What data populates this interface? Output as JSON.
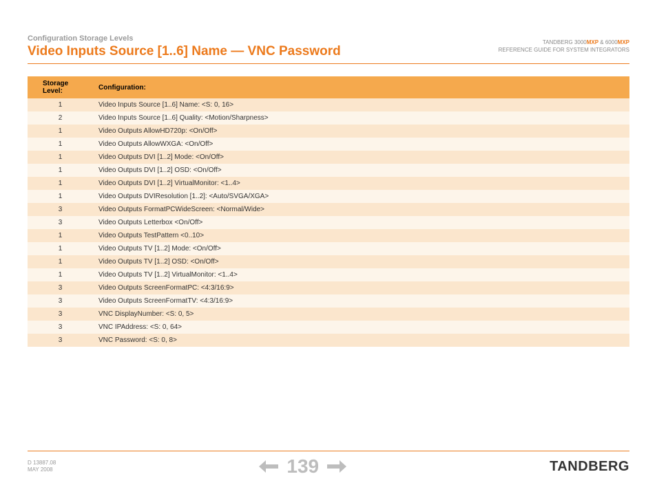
{
  "header": {
    "breadcrumb": "Configuration Storage Levels",
    "title": "Video Inputs Source [1..6] Name — VNC Password",
    "product_line_a": "TANDBERG 3000",
    "product_line_b": " & 6000",
    "mxp": "MXP",
    "subtitle": "REFERENCE GUIDE FOR SYSTEM INTEGRATORS"
  },
  "table": {
    "col1": "Storage Level:",
    "col2": "Configuration:",
    "rows": [
      {
        "level": "1",
        "config": "Video Inputs Source [1..6] Name: <S: 0, 16>"
      },
      {
        "level": "2",
        "config": "Video Inputs Source [1..6] Quality: <Motion/Sharpness>"
      },
      {
        "level": "1",
        "config": "Video Outputs AllowHD720p: <On/Off>"
      },
      {
        "level": "1",
        "config": "Video Outputs AllowWXGA: <On/Off>"
      },
      {
        "level": "1",
        "config": "Video Outputs DVI [1..2] Mode: <On/Off>"
      },
      {
        "level": "1",
        "config": "Video Outputs DVI [1..2] OSD: <On/Off>"
      },
      {
        "level": "1",
        "config": "Video Outputs DVI [1..2] VirtualMonitor: <1..4>"
      },
      {
        "level": "1",
        "config": "Video Outputs DVIResolution [1..2]: <Auto/SVGA/XGA>"
      },
      {
        "level": "3",
        "config": "Video Outputs FormatPCWideScreen: <Normal/Wide>"
      },
      {
        "level": "3",
        "config": "Video Outputs Letterbox <On/Off>"
      },
      {
        "level": "1",
        "config": "Video Outputs TestPattern <0..10>"
      },
      {
        "level": "1",
        "config": "Video Outputs TV [1..2] Mode: <On/Off>"
      },
      {
        "level": "1",
        "config": "Video Outputs TV [1..2] OSD: <On/Off>"
      },
      {
        "level": "1",
        "config": "Video Outputs TV [1..2] VirtualMonitor: <1..4>"
      },
      {
        "level": "3",
        "config": "Video Outputs ScreenFormatPC: <4:3/16:9>"
      },
      {
        "level": "3",
        "config": "Video Outputs ScreenFormatTV: <4:3/16:9>"
      },
      {
        "level": "3",
        "config": "VNC DisplayNumber: <S: 0, 5>"
      },
      {
        "level": "3",
        "config": "VNC IPAddress: <S: 0, 64>"
      },
      {
        "level": "3",
        "config": "VNC Password: <S: 0, 8>"
      }
    ]
  },
  "footer": {
    "doc_id": "D 13887.08",
    "date": "MAY 2008",
    "page": "139",
    "brand": "TANDBERG"
  }
}
